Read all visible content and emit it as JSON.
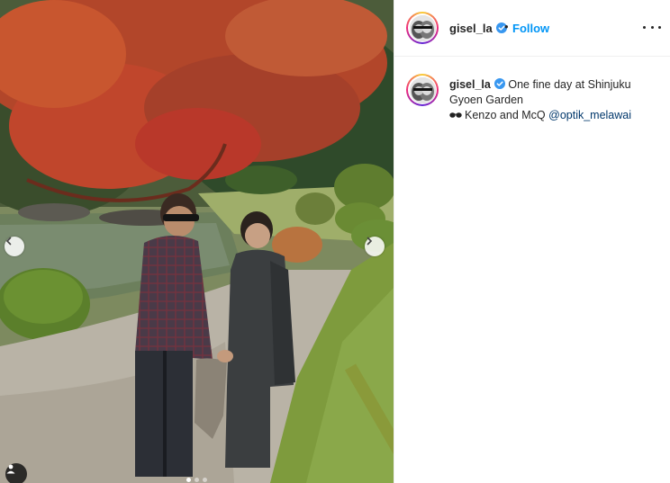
{
  "post": {
    "username": "gisel_la",
    "separator": "•",
    "follow_label": "Follow",
    "caption_line1": "One fine day at Shinjuku",
    "caption_line2": "Gyoen Garden",
    "caption_line3_prefix": "Kenzo and McQ",
    "caption_mention": "@optik_melawai",
    "caption_emoji": "sunglasses-emoji"
  },
  "carousel": {
    "slides": 3,
    "active_index": 0
  },
  "colors": {
    "link": "#0095f6",
    "mention": "#00376b",
    "verified": "#3897f0",
    "text": "#262626"
  },
  "icons": [
    "verified-badge-icon",
    "more-options-icon",
    "chevron-left-icon",
    "chevron-right-icon",
    "user-tag-icon"
  ]
}
